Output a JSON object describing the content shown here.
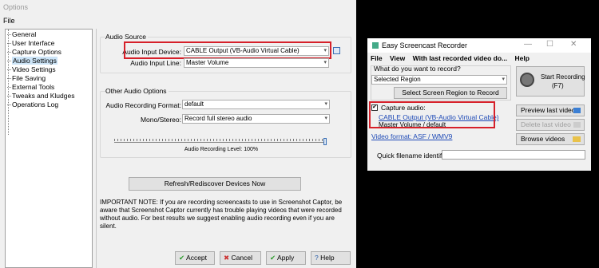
{
  "options_window": {
    "title": "Options",
    "menu": [
      "File"
    ],
    "tree": [
      {
        "label": "General",
        "selected": false
      },
      {
        "label": "User Interface",
        "selected": false
      },
      {
        "label": "Capture Options",
        "selected": false
      },
      {
        "label": "Audio Settings",
        "selected": true
      },
      {
        "label": "Video Settings",
        "selected": false
      },
      {
        "label": "File Saving",
        "selected": false
      },
      {
        "label": "External Tools",
        "selected": false
      },
      {
        "label": "Tweaks and Kludges",
        "selected": false
      },
      {
        "label": "Operations Log",
        "selected": false
      }
    ],
    "audio_source": {
      "title": "Audio Source",
      "input_device_label": "Audio Input Device:",
      "input_device_value": "CABLE Output (VB-Audio Virtual Cable)",
      "input_line_label": "Audio Input Line:",
      "input_line_value": "Master Volume"
    },
    "other_audio": {
      "title": "Other Audio Options",
      "format_label": "Audio Recording Format:",
      "format_value": "default",
      "mono_label": "Mono/Stereo:",
      "mono_value": "Record full stereo audio",
      "level_label": "Audio Recording Level: 100%",
      "level_percent": 100
    },
    "refresh_button": "Refresh/Rediscover Devices Now",
    "note": "IMPORTANT NOTE: If you are recording screencasts to use in Screenshot Captor, be aware that Screenshot Captor currently has trouble playing videos that were recorded without audio.  For best results we suggest enabling audio recording even if you are silent.",
    "buttons": {
      "accept": "Accept",
      "cancel": "Cancel",
      "apply": "Apply",
      "help": "Help"
    },
    "colors": {
      "highlight_box": "#d6202a",
      "selected_item": "#cce4f7"
    }
  },
  "recorder_window": {
    "title": "Easy Screencast Recorder",
    "menu": [
      "File",
      "View",
      "With last recorded video do...",
      "Help"
    ],
    "question": "What do you want to record?",
    "region_value": "Selected Region",
    "select_region_button": "Select Screen Region to Record",
    "start_button": "Start Recording",
    "start_shortcut": "(F7)",
    "capture_audio_label": "Capture audio:",
    "capture_audio_checked": true,
    "audio_device": "CABLE Output (VB-Audio Virtual Cable)",
    "audio_line": "Master Volume / default",
    "video_format": "Video format: ASF / WMV9",
    "preview_button": "Preview last video",
    "delete_button": "Delete last video",
    "browse_button": "Browse videos",
    "quick_id_label": "Quick filename identifier:",
    "quick_id_value": ""
  }
}
